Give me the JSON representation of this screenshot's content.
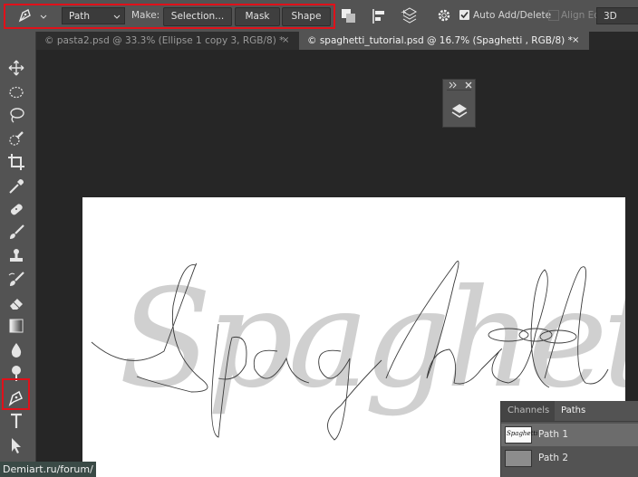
{
  "options_bar": {
    "mode_value": "Path",
    "make_label": "Make:",
    "selection_button": "Selection...",
    "mask_button": "Mask",
    "shape_button": "Shape",
    "auto_add_delete_label": "Auto Add/Delete",
    "auto_add_delete_checked": true,
    "align_edges_label": "Align Ed",
    "workspace_value": "3D"
  },
  "tabs": [
    {
      "label": "© pasta2.psd @ 33.3% (Ellipse 1 copy 3, RGB/8) *",
      "close": "×",
      "active": false
    },
    {
      "label": "© spaghetti_tutorial.psd @ 16.7% (Spaghetti , RGB/8) *",
      "close": "×",
      "active": true
    }
  ],
  "toolbar": {
    "tools": [
      "move-icon",
      "marquee-icon",
      "lasso-icon",
      "quick-select-icon",
      "crop-icon",
      "eyedropper-icon",
      "healing-icon",
      "brush-icon",
      "stamp-icon",
      "history-brush-icon",
      "eraser-icon",
      "gradient-icon",
      "blur-icon",
      "dodge-icon",
      "pen-icon",
      "type-icon",
      "path-select-icon"
    ],
    "active_tool": "pen-icon"
  },
  "canvas": {
    "text": "Spaghetti"
  },
  "paths_panel": {
    "tabs": [
      "Channels",
      "Paths"
    ],
    "active_tab": "Paths",
    "items": [
      {
        "label": "Path 1",
        "thumb_text": "Spaghetti"
      },
      {
        "label": "Path 2"
      }
    ]
  },
  "watermark": "Demiart.ru/forum/",
  "colors": {
    "highlight": "#e0111a",
    "ui_dark": "#535353",
    "background": "#262626"
  }
}
